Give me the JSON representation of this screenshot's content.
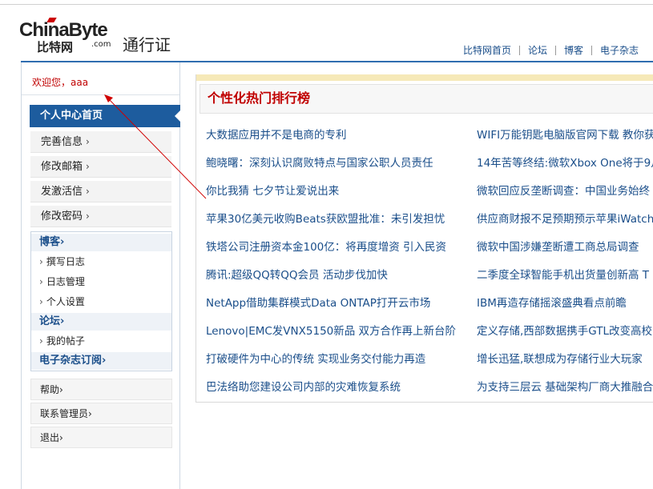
{
  "header": {
    "logo_main": "ChinaByte",
    "logo_sub": "比特网",
    "logo_com": ".com",
    "passport_title": "通行证",
    "nav": [
      "比特网首页",
      "论坛",
      "博客",
      "电子杂志"
    ]
  },
  "sidebar": {
    "welcome": "欢迎您，aaa",
    "home": "个人中心首页",
    "menu": [
      "完善信息",
      "修改邮箱",
      "发激活信",
      "修改密码"
    ],
    "blog_head": "博客",
    "blog_items": [
      "撰写日志",
      "日志管理",
      "个人设置"
    ],
    "forum_head": "论坛",
    "forum_items": [
      "我的帖子"
    ],
    "magazine_head": "电子杂志订阅",
    "bottom": [
      "帮助",
      "联系管理员",
      "退出"
    ]
  },
  "main": {
    "title": "个性化热门排行榜",
    "left_news": [
      "大数据应用并不是电商的专利",
      "鲍晓曙：深刻认识腐败特点与国家公职人员责任",
      "你比我猜 七夕节让爱说出来",
      "苹果30亿美元收购Beats获欧盟批准：未引发担忧",
      "铁塔公司注册资本金100亿：将再度增资 引入民资",
      "腾讯:超级QQ转QQ会员 活动步伐加快",
      "NetApp借助集群模式Data ONTAP打开云市场",
      "Lenovo|EMC发VNX5150新品 双方合作再上新台阶",
      "打破硬件为中心的传统 实现业务交付能力再造",
      "巴法络助您建设公司内部的灾难恢复系统"
    ],
    "right_news": [
      "WIFI万能钥匙电脑版官网下载 教你获",
      "14年苦等终结:微软Xbox One将于9月",
      "微软回应反垄断调查：中国业务始终",
      "供应商财报不足预期预示苹果iWatch",
      "微软中国涉嫌垄断遭工商总局调查",
      "二季度全球智能手机出货量创新高 T",
      "IBM再造存储摇滚盛典看点前瞻",
      "定义存储,西部数据携手GTL改变高校",
      "增长迅猛,联想成为存储行业大玩家",
      "为支持三层云 基础架构厂商大推融合"
    ]
  },
  "colors": {
    "accent_blue": "#1d5c9e",
    "link_blue": "#1a4e8a",
    "title_red": "#c00000",
    "annotation_red": "#d00000"
  }
}
